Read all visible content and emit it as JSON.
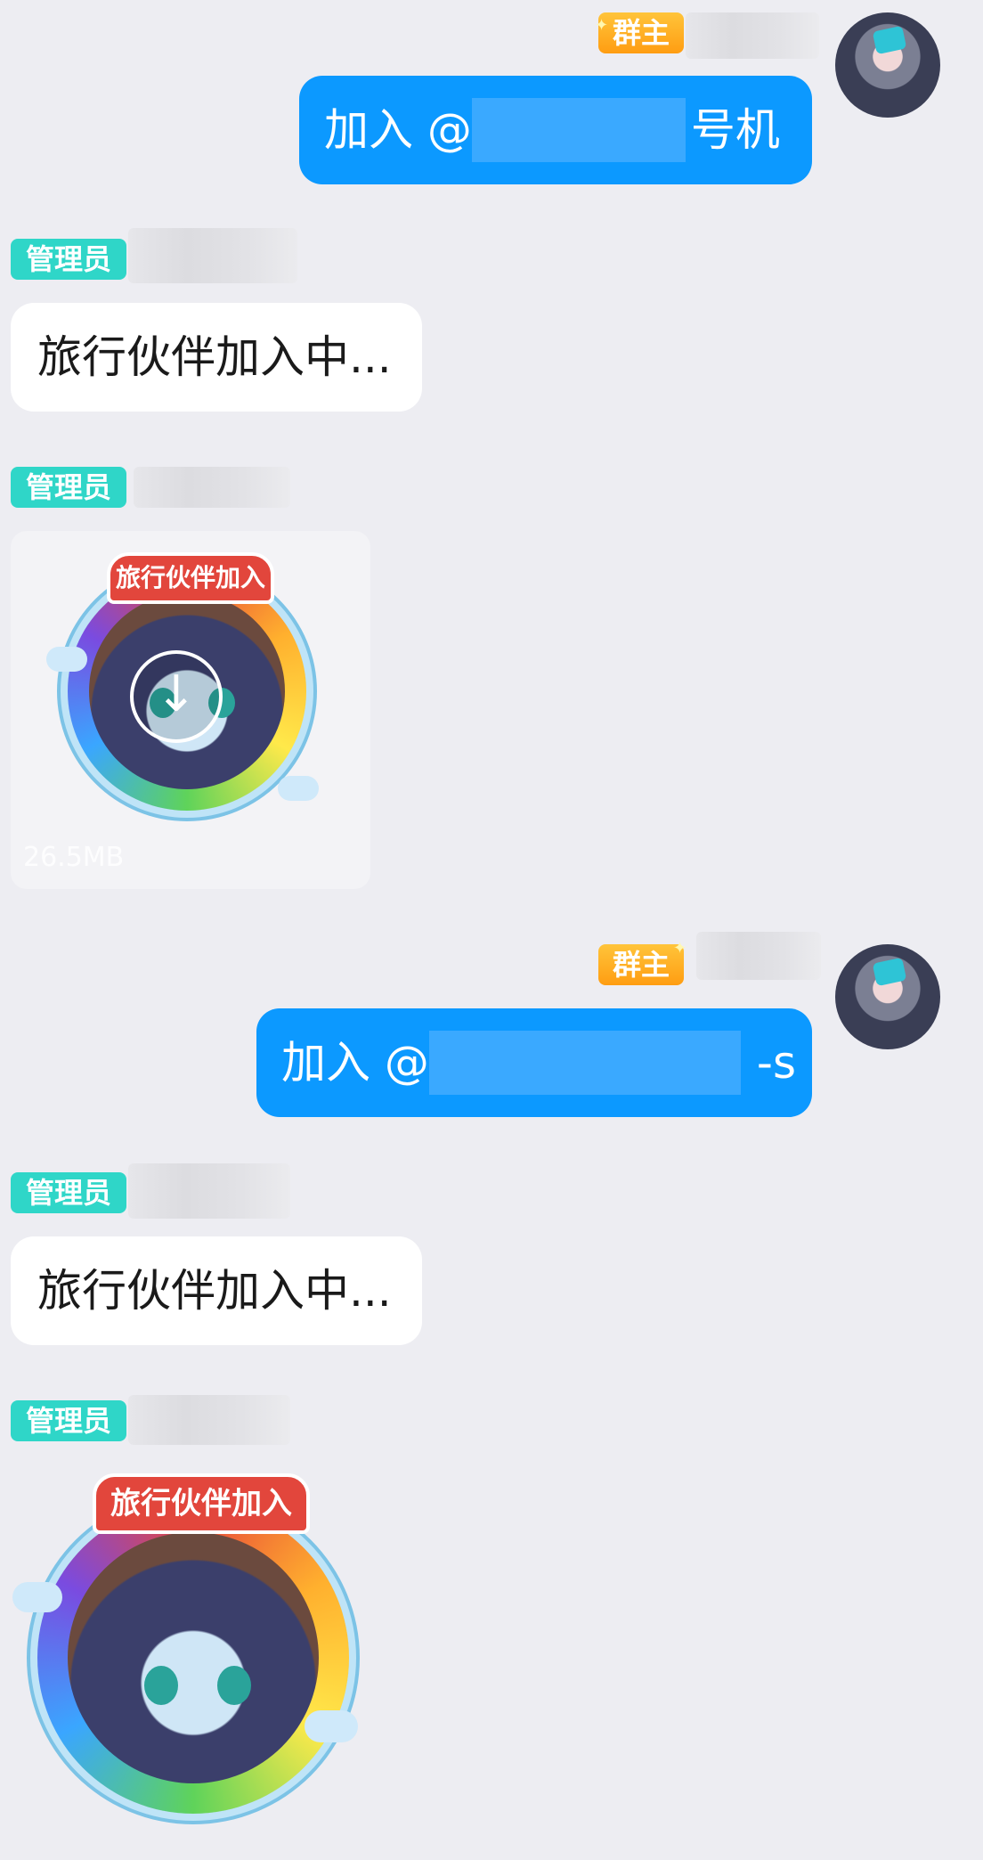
{
  "badges": {
    "owner": "群主",
    "admin": "管理员"
  },
  "messages": [
    {
      "sender": "me",
      "text_prefix": "加入 @",
      "text_suffix": "号机"
    },
    {
      "sender": "admin",
      "text": "旅行伙伴加入中..."
    },
    {
      "sender": "admin",
      "type": "sticker_file",
      "file_size": "26.5MB",
      "sticker_text": "旅行伙伴加入"
    },
    {
      "sender": "me",
      "text_prefix": "加入 @",
      "text_suffix": "-s"
    },
    {
      "sender": "admin",
      "text": "旅行伙伴加入中..."
    },
    {
      "sender": "admin",
      "type": "sticker",
      "sticker_text": "旅行伙伴加入"
    }
  ],
  "colors": {
    "background": "#ededf2",
    "my_bubble": "#0c99ff",
    "their_bubble": "#ffffff",
    "admin_badge": "#2fd6c8",
    "owner_badge": "#ffa81f"
  },
  "icons": {
    "download": "download-arrow-icon"
  }
}
